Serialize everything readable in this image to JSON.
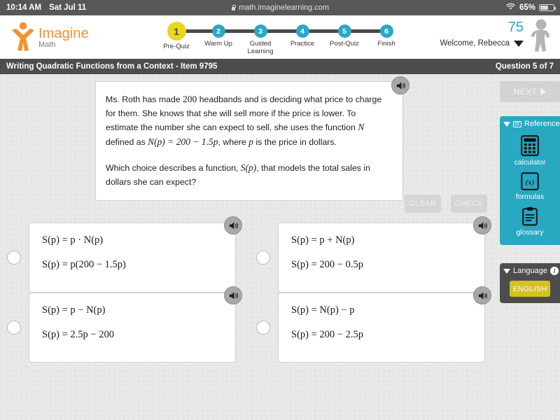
{
  "statusbar": {
    "time": "10:14 AM",
    "date": "Sat Jul 11",
    "url": "math.imaginelearning.com",
    "battery_percent": "65%",
    "lock_icon": "lock-icon",
    "wifi_icon": "wifi-icon",
    "battery_icon": "battery-icon"
  },
  "header": {
    "logo_primary": "Imagine",
    "logo_secondary": "Math",
    "score": "75",
    "welcome": "Welcome, Rebecca",
    "avatar_icon": "avatar-icon",
    "caret_icon": "chevron-down-icon",
    "steps": [
      {
        "number": "1",
        "label": "Pre-Quiz",
        "active": true
      },
      {
        "number": "2",
        "label": "Warm Up",
        "active": false
      },
      {
        "number": "3",
        "label": "Guided Learning",
        "active": false
      },
      {
        "number": "4",
        "label": "Practice",
        "active": false
      },
      {
        "number": "5",
        "label": "Post-Quiz",
        "active": false
      },
      {
        "number": "6",
        "label": "Finish",
        "active": false
      }
    ]
  },
  "titlebar": {
    "lesson": "Writing Quadratic Functions from a Context - Item 9795",
    "question_counter": "Question 5 of 7"
  },
  "question": {
    "paragraph1_a": "Ms. Roth has made ",
    "paragraph1_num": "200",
    "paragraph1_b": " headbands and is deciding what price to charge for them. She knows that she will sell more if the price is lower. To estimate the number she can expect to sell, she uses the function ",
    "paragraph1_var": "N",
    "paragraph1_c": " defined as ",
    "paragraph1_formula": "N(p) = 200 − 1.5p",
    "paragraph1_d": ", where ",
    "paragraph1_var2": "p",
    "paragraph1_e": " is the price in dollars.",
    "paragraph2_a": "Which choice describes a function, ",
    "paragraph2_func": "S(p)",
    "paragraph2_b": ", that models the total sales in dollars she can expect?",
    "speaker_icon": "speaker-icon"
  },
  "actions": {
    "clear_label": "CLEAR",
    "check_label": "CHECK",
    "next_label": "NEXT",
    "next_icon": "play-triangle-icon"
  },
  "choices": [
    {
      "id": "choice-a",
      "line1": "S(p) = p · N(p)",
      "line2": "S(p) = p(200 − 1.5p)",
      "selected": false
    },
    {
      "id": "choice-b",
      "line1": "S(p) = p + N(p)",
      "line2": "S(p) = 200 − 0.5p",
      "selected": false
    },
    {
      "id": "choice-c",
      "line1": "S(p) = p − N(p)",
      "line2": "S(p) = 2.5p − 200",
      "selected": false
    },
    {
      "id": "choice-d",
      "line1": "S(p) = N(p) − p",
      "line2": "S(p) = 200 − 2.5p",
      "selected": false
    }
  ],
  "reference_panel": {
    "title": "Reference",
    "collapse_icon": "triangle-down-icon",
    "header_icon": "reference-icon",
    "tools": [
      {
        "label": "calculator",
        "icon": "calculator-icon"
      },
      {
        "label": "formulas",
        "icon": "formulas-icon"
      },
      {
        "label": "glossary",
        "icon": "clipboard-icon"
      }
    ]
  },
  "language_panel": {
    "title": "Language",
    "collapse_icon": "triangle-down-icon",
    "info_icon": "info-icon",
    "selected_language": "ENGLISH"
  },
  "colors": {
    "teal": "#29a8c2",
    "yellow_step": "#e9d61e",
    "yellow_button": "#d4c223",
    "orange_logo": "#f4912e",
    "dark_bar": "#4d4d4d"
  }
}
